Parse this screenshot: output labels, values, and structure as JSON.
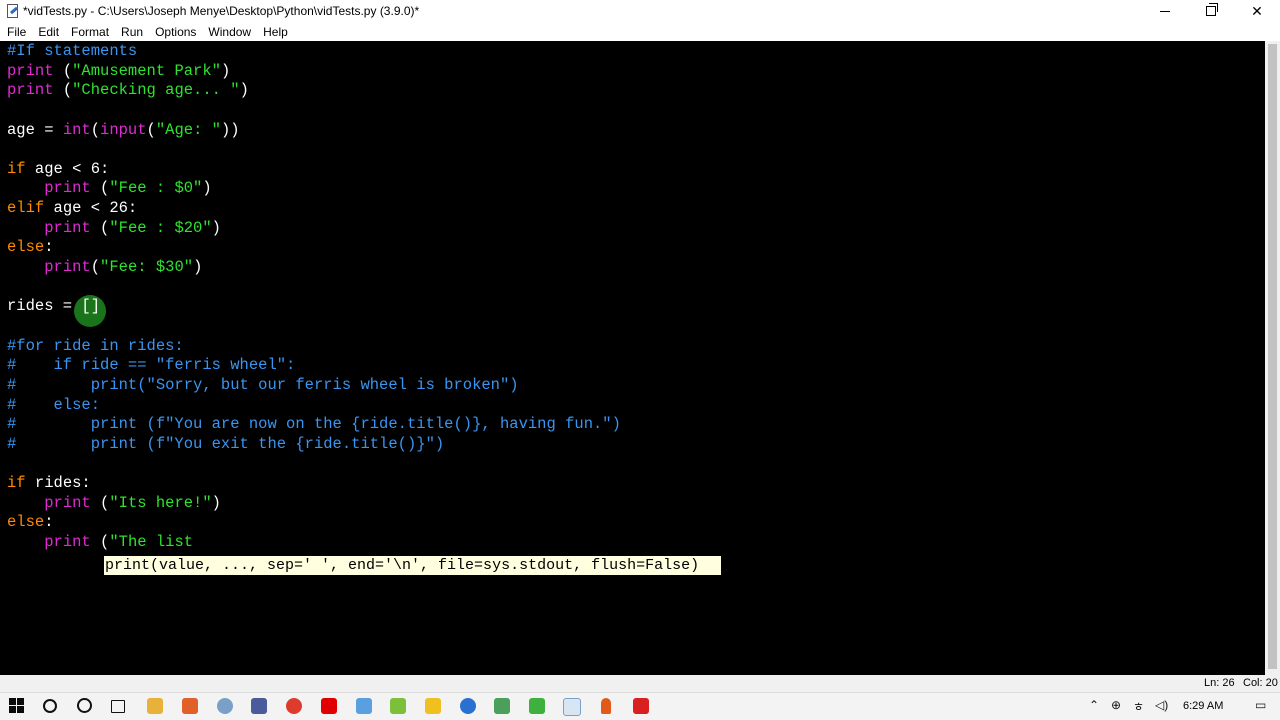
{
  "window": {
    "title": "*vidTests.py - C:\\Users\\Joseph Menye\\Desktop\\Python\\vidTests.py (3.9.0)*"
  },
  "menu": [
    "File",
    "Edit",
    "Format",
    "Run",
    "Options",
    "Window",
    "Help"
  ],
  "editor": {
    "lines": [
      [
        [
          "cm",
          "#If statements"
        ]
      ],
      [
        [
          "bi",
          "print"
        ],
        [
          "",
          " ("
        ],
        [
          "str",
          "\"Amusement Park\""
        ],
        [
          "",
          ")"
        ]
      ],
      [
        [
          "bi",
          "print"
        ],
        [
          "",
          " ("
        ],
        [
          "str",
          "\"Checking age... \""
        ],
        [
          "",
          ")"
        ]
      ],
      [],
      [
        [
          "",
          "age = "
        ],
        [
          "bi",
          "int"
        ],
        [
          "",
          "("
        ],
        [
          "bi",
          "input"
        ],
        [
          "",
          "("
        ],
        [
          "str",
          "\"Age: \""
        ],
        [
          "",
          "))"
        ]
      ],
      [],
      [
        [
          "kw",
          "if"
        ],
        [
          "",
          " age < 6:"
        ]
      ],
      [
        [
          "",
          "    "
        ],
        [
          "bi",
          "print"
        ],
        [
          "",
          " ("
        ],
        [
          "str",
          "\"Fee : $0\""
        ],
        [
          "",
          ")"
        ]
      ],
      [
        [
          "kw",
          "elif"
        ],
        [
          "",
          " age < 26:"
        ]
      ],
      [
        [
          "",
          "    "
        ],
        [
          "bi",
          "print"
        ],
        [
          "",
          " ("
        ],
        [
          "str",
          "\"Fee : $20\""
        ],
        [
          "",
          ")"
        ]
      ],
      [
        [
          "kw",
          "else"
        ],
        [
          "",
          ":"
        ]
      ],
      [
        [
          "",
          "    "
        ],
        [
          "bi",
          "print"
        ],
        [
          "",
          "("
        ],
        [
          "str",
          "\"Fee: $30\""
        ],
        [
          "",
          ")"
        ]
      ],
      [],
      [
        [
          "",
          "rides = []"
        ]
      ],
      [],
      [
        [
          "cm",
          "#for ride in rides:"
        ]
      ],
      [
        [
          "cm",
          "#    if ride == \"ferris wheel\":"
        ]
      ],
      [
        [
          "cm",
          "#        print(\"Sorry, but our ferris wheel is broken\")"
        ]
      ],
      [
        [
          "cm",
          "#    else:"
        ]
      ],
      [
        [
          "cm",
          "#        print (f\"You are now on the {ride.title()}, having fun.\")"
        ]
      ],
      [
        [
          "cm",
          "#        print (f\"You exit the {ride.title()}\")"
        ]
      ],
      [],
      [
        [
          "kw",
          "if"
        ],
        [
          "",
          " rides:"
        ]
      ],
      [
        [
          "",
          "    "
        ],
        [
          "bi",
          "print"
        ],
        [
          "",
          " ("
        ],
        [
          "str",
          "\"Its here!\""
        ],
        [
          "",
          ")"
        ]
      ],
      [
        [
          "kw",
          "else"
        ],
        [
          "",
          ":"
        ]
      ],
      [
        [
          "",
          "    "
        ],
        [
          "bi",
          "print"
        ],
        [
          "",
          " ("
        ],
        [
          "str",
          "\"The list"
        ]
      ]
    ],
    "calltip": "print(value, ..., sep=' ', end='\\n', file=sys.stdout, flush=False)"
  },
  "status": {
    "line": "Ln: 26",
    "col": "Col: 20"
  },
  "taskbar": {
    "time": "6:29 AM"
  },
  "colors": {
    "keyword": "#ff8a00",
    "builtin": "#e02bd3",
    "string": "#2ee32e",
    "comment": "#3a95f0",
    "background": "#000000"
  }
}
